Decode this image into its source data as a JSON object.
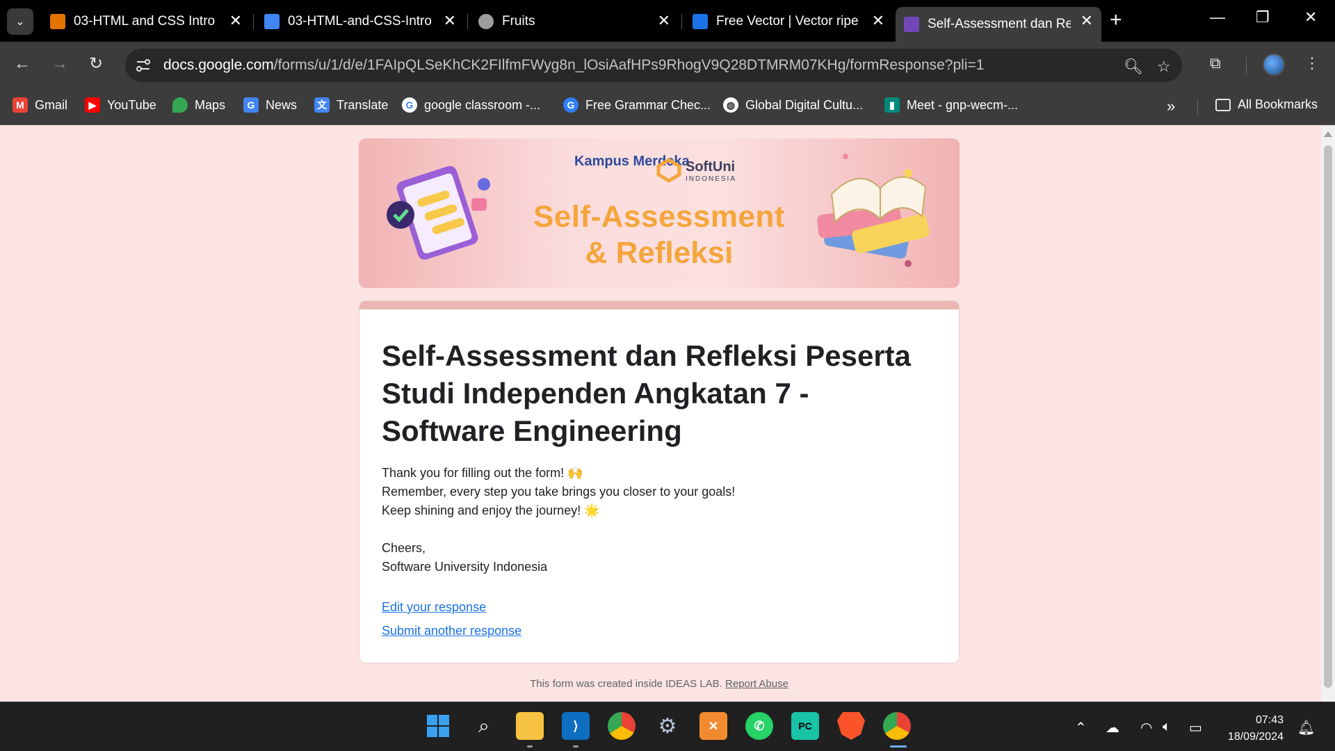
{
  "browser": {
    "tabs": [
      {
        "title": "03-HTML and CSS Intro",
        "icon": "slides-icon",
        "color": "#e37400",
        "active": false
      },
      {
        "title": "03-HTML-and-CSS-Intro",
        "icon": "docs-icon",
        "color": "#4285f4",
        "active": false
      },
      {
        "title": "Fruits",
        "icon": "globe-icon",
        "color": "#9e9e9e",
        "active": false
      },
      {
        "title": "Free Vector | Vector ripe y",
        "icon": "freepik-icon",
        "color": "#1a73e8",
        "active": false
      },
      {
        "title": "Self-Assessment dan Refl",
        "icon": "forms-icon",
        "color": "#7248b9",
        "active": true
      }
    ],
    "url_host": "docs.google.com",
    "url_path": "/forms/u/1/d/e/1FAIpQLSeKhCK2FIlfmFWyg8n_lOsiAafHPs9RhogV9Q28DTMRM07KHg/formResponse?pli=1",
    "bookmarks": [
      {
        "label": "Gmail",
        "icon": "gmail-icon",
        "color": "#ea4335"
      },
      {
        "label": "YouTube",
        "icon": "youtube-icon",
        "color": "#ff0000"
      },
      {
        "label": "Maps",
        "icon": "maps-icon",
        "color": "#34a853"
      },
      {
        "label": "News",
        "icon": "news-icon",
        "color": "#4285f4"
      },
      {
        "label": "Translate",
        "icon": "translate-icon",
        "color": "#4285f4"
      },
      {
        "label": "google classroom -...",
        "icon": "google-icon",
        "color": "#ffffff"
      },
      {
        "label": "Free Grammar Chec...",
        "icon": "grammar-icon",
        "color": "#2d7ef7"
      },
      {
        "label": "Global Digital Cultu...",
        "icon": "globe-icon",
        "color": "#ffffff"
      },
      {
        "label": "Meet - gnp-wecm-...",
        "icon": "meet-icon",
        "color": "#00897b"
      }
    ],
    "all_bookmarks": "All Bookmarks"
  },
  "banner": {
    "logo_kampus": "Kampus Merdeka",
    "logo_softuni": "SoftUni",
    "logo_softuni_sub": "INDONESIA",
    "title_line1": "Self-Assessment",
    "title_line2": "& Refleksi"
  },
  "form": {
    "title": "Self-Assessment dan Refleksi Peserta Studi Independen Angkatan 7 - Software Engineering",
    "message_lines": [
      "Thank you for filling out the form! 🙌",
      "Remember, every step you take brings you closer to your goals!",
      "Keep shining and enjoy the journey! 🌟",
      "",
      "Cheers,",
      "Software University Indonesia"
    ],
    "edit_link": "Edit your response",
    "submit_another_link": "Submit another response"
  },
  "footer": {
    "text": "This form was created inside IDEAS LAB.",
    "report_link": "Report Abuse"
  },
  "taskbar": {
    "time": "07:43",
    "date": "18/09/2024"
  }
}
